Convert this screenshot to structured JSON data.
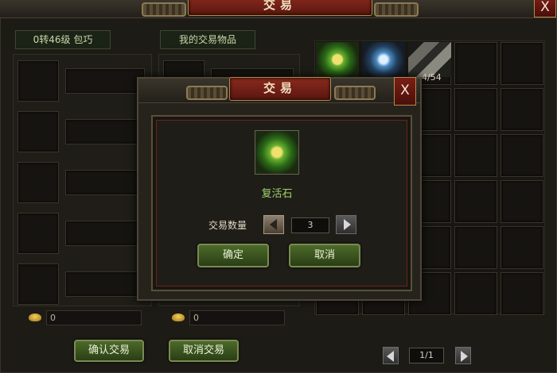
{
  "window": {
    "title": "交易",
    "close_label": "X"
  },
  "left_label": "0转46级 包巧",
  "right_label": "我的交易物品",
  "inventory": {
    "count": "4/54",
    "page": "1/1"
  },
  "money": {
    "left": "0",
    "right": "0"
  },
  "buttons": {
    "confirm_trade": "确认交易",
    "cancel_trade": "取消交易"
  },
  "dialog": {
    "title": "交易",
    "close_label": "X",
    "item_name": "复活石",
    "quantity_label": "交易数量",
    "quantity_value": "3",
    "ok_label": "确定",
    "cancel_label": "取消"
  },
  "colors": {
    "accent_red": "#6e1a12",
    "button_green": "#3c5a20",
    "item_name": "#9fd46a"
  }
}
